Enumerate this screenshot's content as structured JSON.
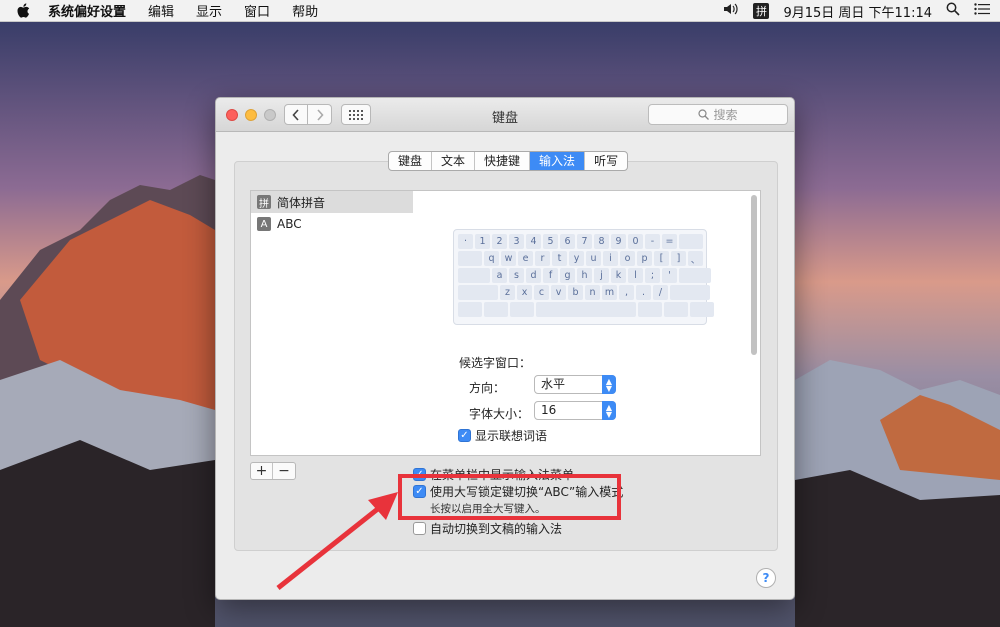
{
  "menubar": {
    "app": "系统偏好设置",
    "items": [
      "编辑",
      "显示",
      "窗口",
      "帮助"
    ],
    "ime": "拼",
    "datetime": "9月15日 周日 下午11:14"
  },
  "window": {
    "title": "键盘",
    "search_placeholder": "搜索",
    "tabs": [
      "键盘",
      "文本",
      "快捷键",
      "输入法",
      "听写"
    ],
    "active_tab": "输入法"
  },
  "input_sources": [
    {
      "icon": "拼",
      "label": "简体拼音",
      "selected": true
    },
    {
      "icon": "A",
      "label": "ABC",
      "selected": false
    }
  ],
  "keyboard": {
    "rows": [
      [
        "·",
        "1",
        "2",
        "3",
        "4",
        "5",
        "6",
        "7",
        "8",
        "9",
        "0",
        "-",
        "="
      ],
      [
        "q",
        "w",
        "e",
        "r",
        "t",
        "y",
        "u",
        "i",
        "o",
        "p",
        "[",
        "]",
        "、"
      ],
      [
        "a",
        "s",
        "d",
        "f",
        "g",
        "h",
        "j",
        "k",
        "l",
        ";",
        "'"
      ],
      [
        "z",
        "x",
        "c",
        "v",
        "b",
        "n",
        "m",
        ",",
        ".",
        "/"
      ]
    ]
  },
  "candidate": {
    "title": "候选字窗口：",
    "direction_label": "方向：",
    "direction_value": "水平",
    "font_size_label": "字体大小：",
    "font_size_value": "16",
    "show_predictions": "显示联想词语"
  },
  "options": {
    "show_in_menubar": "在菜单栏中显示输入法菜单",
    "capslock_switch": "使用大写锁定键切换“ABC”输入模式",
    "capslock_hint": "长按以启用全大写键入。",
    "auto_switch": "自动切换到文稿的输入法"
  },
  "buttons": {
    "add": "+",
    "remove": "−",
    "help": "?"
  },
  "colors": {
    "accent": "#3d8bf5",
    "annotation": "#e8333b"
  }
}
